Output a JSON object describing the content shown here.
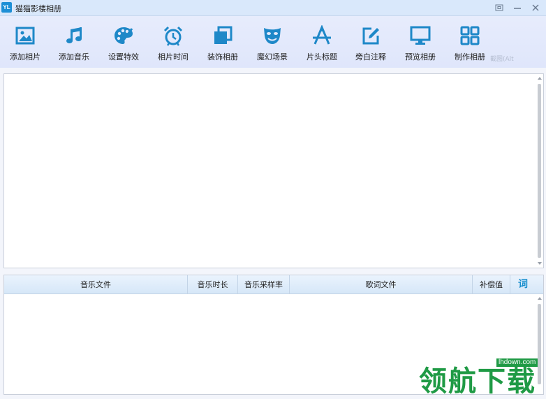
{
  "window": {
    "logo_text": "YL",
    "title": "猫猫影楼相册"
  },
  "toolbar": {
    "items": [
      {
        "label": "添加相片",
        "icon": "add-photo-icon"
      },
      {
        "label": "添加音乐",
        "icon": "music-note-icon"
      },
      {
        "label": "设置特效",
        "icon": "palette-icon"
      },
      {
        "label": "相片时间",
        "icon": "alarm-clock-icon"
      },
      {
        "label": "装饰相册",
        "icon": "layered-frames-icon"
      },
      {
        "label": "魔幻场景",
        "icon": "theater-masks-icon"
      },
      {
        "label": "片头标题",
        "icon": "title-letter-icon"
      },
      {
        "label": "旁白注释",
        "icon": "edit-pencil-icon"
      },
      {
        "label": "预览相册",
        "icon": "monitor-icon"
      },
      {
        "label": "制作相册",
        "icon": "grid-icon"
      }
    ],
    "accent_color": "#1e88c8",
    "ghost_text": "截图(Alt"
  },
  "music_table": {
    "headers": [
      "音乐文件",
      "音乐时长",
      "音乐采样率",
      "歌词文件",
      "补偿值",
      "词"
    ]
  },
  "watermark": {
    "text": "领航下载",
    "url": "lhdown.com"
  }
}
